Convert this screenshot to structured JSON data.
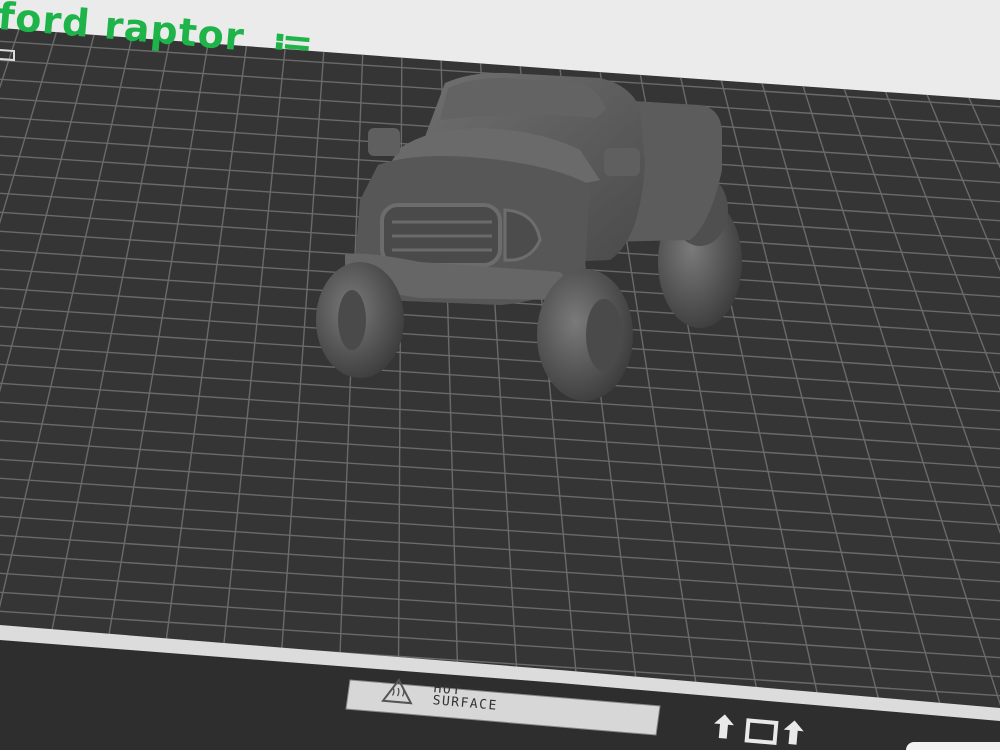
{
  "model": {
    "name": "ford raptor"
  },
  "plate": {
    "warning_line1": "HOT",
    "warning_line2": "SURFACE",
    "warning_icon": "hot-surface-icon",
    "plate_color": "#333333",
    "grid_color": "#6a6a6a",
    "accent": "#1fb44a"
  },
  "object": {
    "name": "truck-model",
    "color": "#585858"
  }
}
